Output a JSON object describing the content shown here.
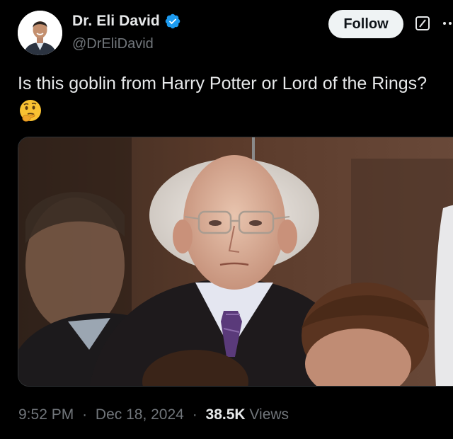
{
  "author": {
    "display_name": "Dr. Eli David",
    "handle": "@DrEliDavid",
    "verified": true,
    "verified_color": "#1d9bf0"
  },
  "actions": {
    "follow_label": "Follow"
  },
  "tweet": {
    "text": "Is this goblin from Harry Potter or Lord of the Rings?",
    "emoji": "thinking-face"
  },
  "meta": {
    "time": "9:52 PM",
    "separator": "·",
    "date": "Dec 18, 2024",
    "views_count": "38.5K",
    "views_label": "Views"
  },
  "colors": {
    "background": "#000000",
    "text_primary": "#e7e9ea",
    "text_secondary": "#71767b",
    "follow_bg": "#eff3f4"
  },
  "icons": {
    "verified": "verified-badge-icon",
    "grok": "grok-icon",
    "more": "more-horizontal-icon"
  }
}
